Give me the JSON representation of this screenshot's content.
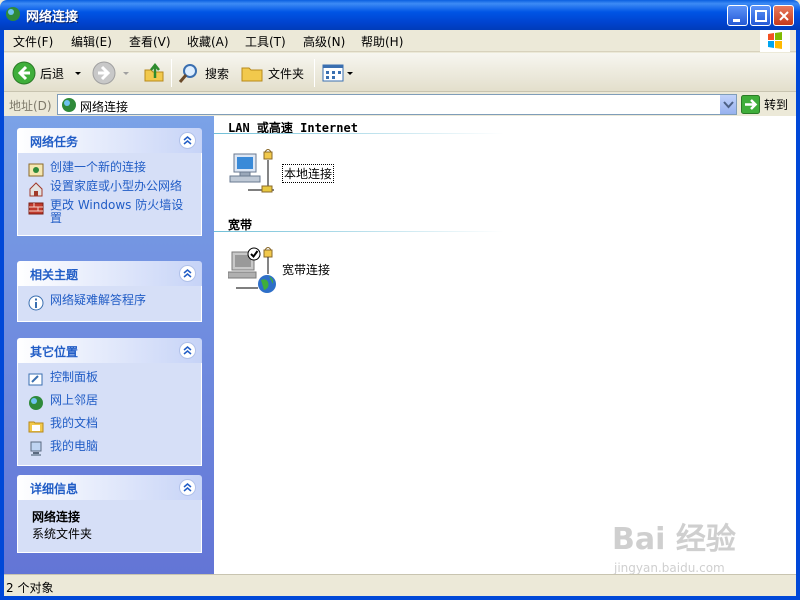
{
  "window": {
    "title": "网络连接"
  },
  "menu": {
    "items": [
      "文件(F)",
      "编辑(E)",
      "查看(V)",
      "收藏(A)",
      "工具(T)",
      "高级(N)",
      "帮助(H)"
    ]
  },
  "toolbar": {
    "back_label": "后退",
    "search_label": "搜索",
    "folders_label": "文件夹"
  },
  "address": {
    "label": "地址(D)",
    "value": "网络连接",
    "go_label": "转到"
  },
  "taskpane": {
    "network_tasks": {
      "title": "网络任务",
      "items": [
        "创建一个新的连接",
        "设置家庭或小型办公网络",
        "更改 Windows 防火墙设置"
      ]
    },
    "related_topics": {
      "title": "相关主题",
      "items": [
        "网络疑难解答程序"
      ]
    },
    "other_places": {
      "title": "其它位置",
      "items": [
        "控制面板",
        "网上邻居",
        "我的文档",
        "我的电脑"
      ]
    },
    "details": {
      "title": "详细信息",
      "name": "网络连接",
      "type": "系统文件夹"
    }
  },
  "content": {
    "groups": [
      {
        "title": "LAN 或高速 Internet",
        "connections": [
          {
            "label": "本地连接"
          }
        ]
      },
      {
        "title": "宽带",
        "connections": [
          {
            "label": "宽带连接"
          }
        ]
      }
    ]
  },
  "status": {
    "text": "2 个对象"
  },
  "watermark": {
    "brand": "Bai 经验",
    "url": "jingyan.baidu.com"
  },
  "colors": {
    "title_bar": "#0055E5",
    "link": "#215DC6",
    "pane_bg": "#6375D6"
  }
}
